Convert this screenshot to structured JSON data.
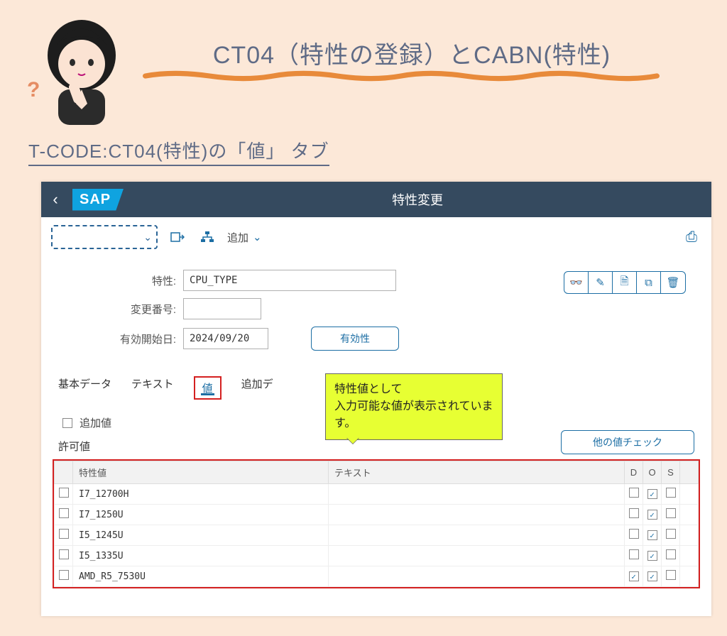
{
  "page": {
    "title": "CT04（特性の登録）とCABN(特性)",
    "subtitle": "T-CODE:CT04(特性)の「値」 タブ"
  },
  "sap": {
    "logo": "SAP",
    "back_glyph": "‹",
    "window_title": "特性変更",
    "toolbar": {
      "add_label": "追加",
      "chevron": "⌄",
      "print_glyph": "⎙"
    },
    "form": {
      "char_label": "特性:",
      "char_value": "CPU_TYPE",
      "change_no_label": "変更番号:",
      "change_no_value": "",
      "valid_from_label": "有効開始日:",
      "valid_from_value": "2024/09/20",
      "validity_btn": "有効性"
    },
    "icon_group": {
      "view": "👓",
      "edit": "✎",
      "create": "🗎",
      "copy": "⧉",
      "delete": "🗑"
    },
    "tabs": {
      "basic": "基本データ",
      "text": "テキスト",
      "values": "値",
      "addl": "追加デ"
    },
    "callout": "特性値として\n入力可能な値が表示されています。",
    "additional_values_label": "追加値",
    "other_value_check": "他の値チェック",
    "allowed_values_title": "許可値",
    "table": {
      "headers": {
        "value": "特性値",
        "text": "テキスト",
        "d": "D",
        "o": "O",
        "s": "S"
      },
      "rows": [
        {
          "value": "I7_12700H",
          "text": "",
          "d": false,
          "o": true,
          "s": false
        },
        {
          "value": "I7_1250U",
          "text": "",
          "d": false,
          "o": true,
          "s": false
        },
        {
          "value": "I5_1245U",
          "text": "",
          "d": false,
          "o": true,
          "s": false
        },
        {
          "value": "I5_1335U",
          "text": "",
          "d": false,
          "o": true,
          "s": false
        },
        {
          "value": "AMD_R5_7530U",
          "text": "",
          "d": true,
          "o": true,
          "s": false
        }
      ]
    }
  }
}
